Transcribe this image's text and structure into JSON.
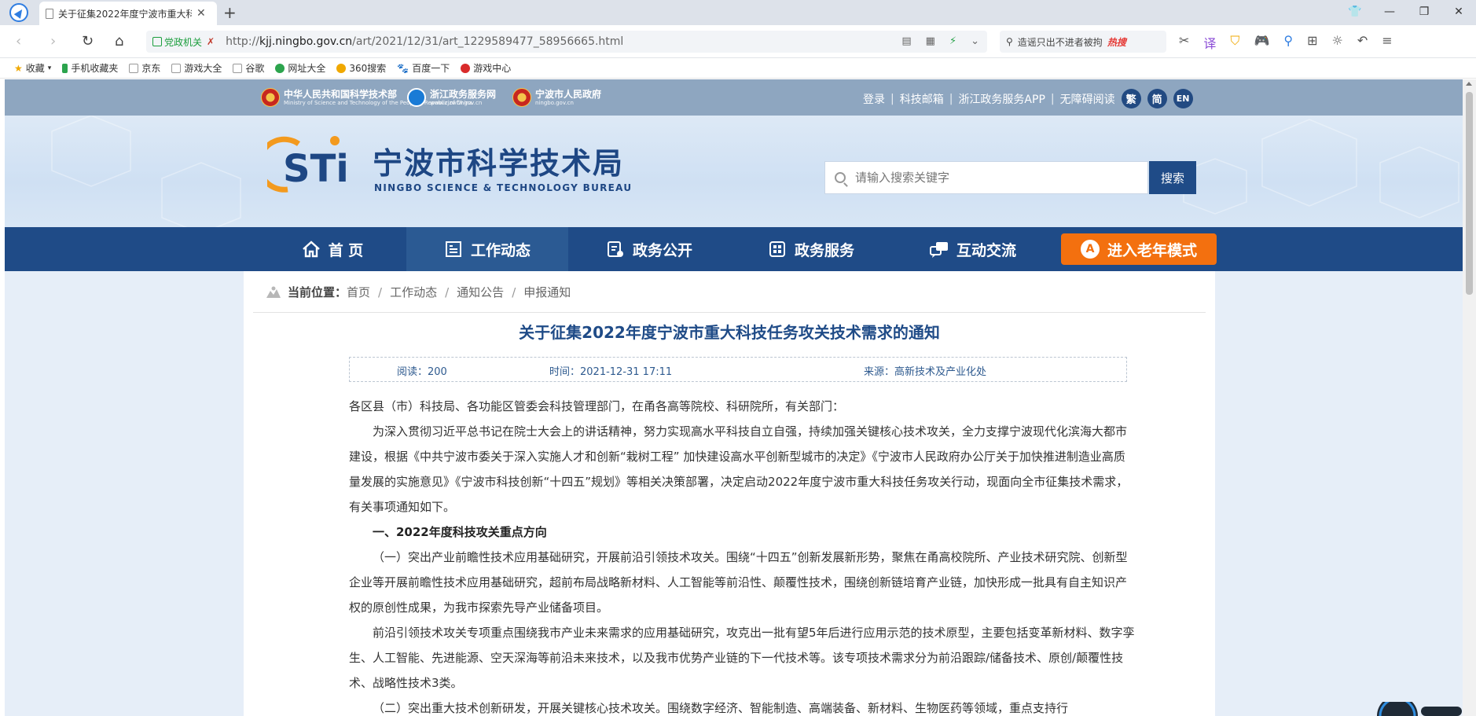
{
  "browser": {
    "tab_title": "关于征集2022年度宁波市重大科",
    "url_badge": "党政机关",
    "url_prefix": "http://",
    "url_domain": "kjj.ningbo.gov.cn",
    "url_path": "/art/2021/12/31/art_1229589477_58956665.html",
    "search_text": "造谣只出不进者被拘",
    "search_hot": "热搜",
    "bookmarks": [
      "收藏",
      "手机收藏夹",
      "京东",
      "游戏大全",
      "谷歌",
      "网址大全",
      "360搜索",
      "百度一下",
      "游戏中心"
    ]
  },
  "top": {
    "partners": [
      {
        "name": "中华人民共和国科学技术部",
        "sub": "Ministry of Science and Technology of the People's Republic of China"
      },
      {
        "name": "浙江政务服务网",
        "sub": "www.zjzwfw.gov.cn"
      },
      {
        "name": "宁波市人民政府",
        "sub": "ningbo.gov.cn"
      }
    ],
    "links": [
      "登录",
      "科技邮箱",
      "浙江政务服务APP",
      "无障碍阅读"
    ],
    "lang": [
      "繁",
      "简",
      "EN"
    ]
  },
  "header": {
    "title": "宁波市科学技术局",
    "subtitle": "NINGBO SCIENCE & TECHNOLOGY BUREAU",
    "logo_text": "STi",
    "search_placeholder": "请输入搜索关键字",
    "search_button": "搜索"
  },
  "nav": {
    "items": [
      "首 页",
      "工作动态",
      "政务公开",
      "政务服务",
      "互动交流"
    ],
    "elder_mode": "进入老年模式",
    "elder_icon": "A"
  },
  "breadcrumb": {
    "label": "当前位置：",
    "items": [
      "首页",
      "工作动态",
      "通知公告",
      "申报通知"
    ]
  },
  "article": {
    "title": "关于征集2022年度宁波市重大科技任务攻关技术需求的通知",
    "reads": "阅读：200",
    "time": "时间：2021-12-31 17:11",
    "source": "来源：高新技术及产业化处",
    "paragraphs": [
      "各区县（市）科技局、各功能区管委会科技管理部门，在甬各高等院校、科研院所，有关部门：",
      "为深入贯彻习近平总书记在院士大会上的讲话精神，努力实现高水平科技自立自强，持续加强关键核心技术攻关，全力支撑宁波现代化滨海大都市建设，根据《中共宁波市委关于深入实施人才和创新“栽树工程” 加快建设高水平创新型城市的决定》《宁波市人民政府办公厅关于加快推进制造业高质量发展的实施意见》《宁波市科技创新“十四五”规划》等相关决策部署，决定启动2022年度宁波市重大科技任务攻关行动，现面向全市征集技术需求，有关事项通知如下。",
      "一、2022年度科技攻关重点方向",
      "（一）突出产业前瞻性技术应用基础研究，开展前沿引领技术攻关。围绕“十四五”创新发展新形势，聚焦在甬高校院所、产业技术研究院、创新型企业等开展前瞻性技术应用基础研究，超前布局战略新材料、人工智能等前沿性、颠覆性技术，围绕创新链培育产业链，加快形成一批具有自主知识产权的原创性成果，为我市探索先导产业储备项目。",
      "前沿引领技术攻关专项重点围绕我市产业未来需求的应用基础研究，攻克出一批有望5年后进行应用示范的技术原型，主要包括变革新材料、数字孪生、人工智能、先进能源、空天深海等前沿未来技术，以及我市优势产业链的下一代技术等。该专项技术需求分为前沿跟踪/储备技术、原创/颠覆性技术、战略性技术3类。",
      "（二）突出重大技术创新研发，开展关键核心技术攻关。围绕数字经济、智能制造、高端装备、新材料、生物医药等领域，重点支持行"
    ]
  },
  "colors": {
    "nav_blue": "#1f4b87",
    "accent_orange": "#f3700f",
    "title_blue": "#1f4b87",
    "strip": "#8ea6c0"
  }
}
